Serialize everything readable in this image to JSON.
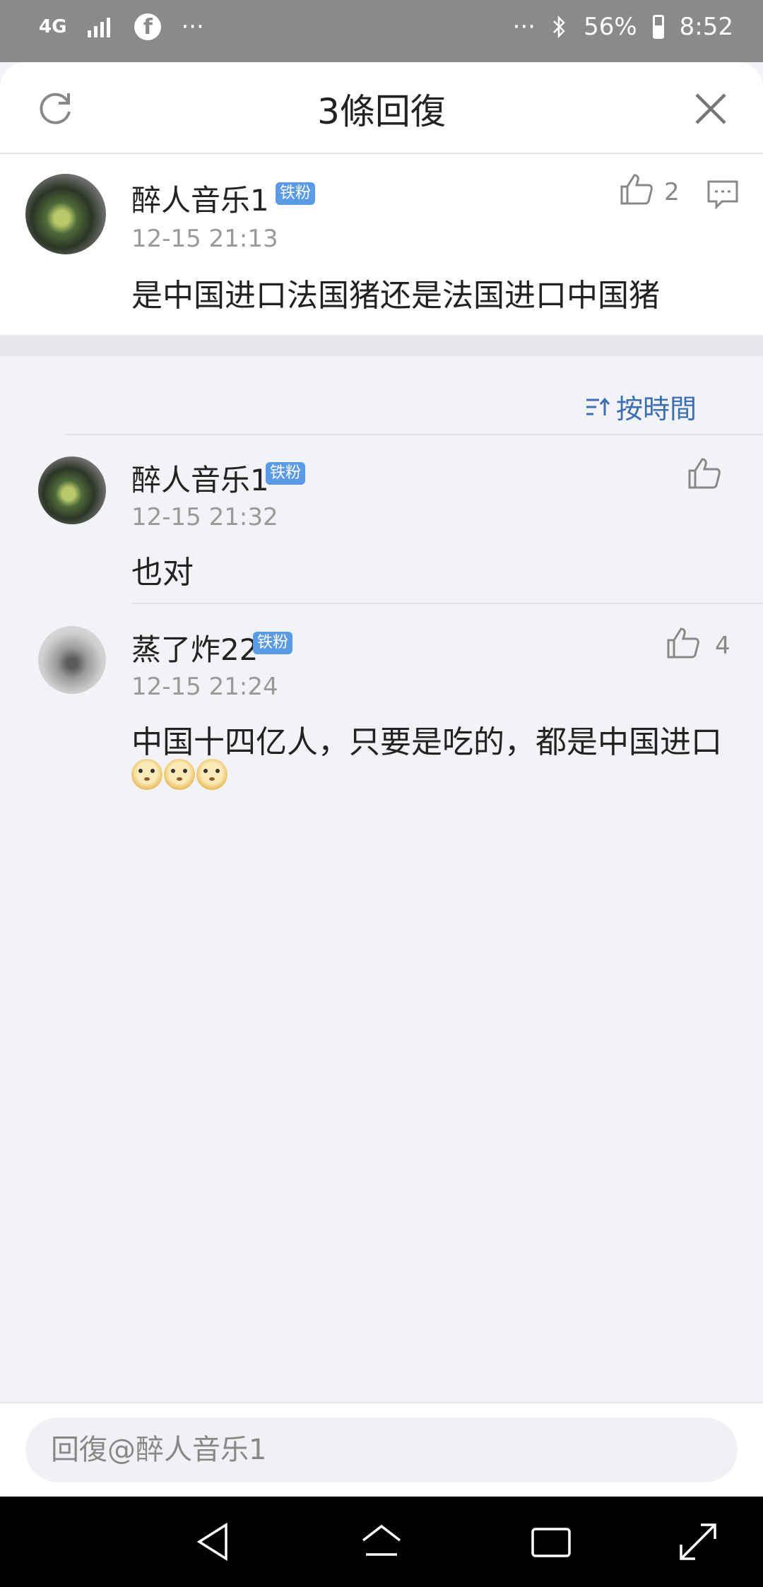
{
  "status_bar": {
    "network": "4G",
    "more_left": "···",
    "more_right": "···",
    "battery": "56%",
    "time": "8:52",
    "icons": [
      "network-4g-icon",
      "signal-icon",
      "facebook-icon",
      "bluetooth-icon",
      "battery-icon"
    ]
  },
  "header": {
    "title": "3條回復"
  },
  "main_comment": {
    "user": "醉人音乐1",
    "badge": "铁粉",
    "time": "12-15 21:13",
    "text": "是中国进口法国猪还是法国进口中国猪",
    "likes": "2"
  },
  "replies": {
    "sort_label": "按時間",
    "items": [
      {
        "user": "醉人音乐1",
        "badge": "铁粉",
        "time": "12-15 21:32",
        "text": "也对",
        "likes": ""
      },
      {
        "user": "蒸了炸22",
        "badge": "铁粉",
        "time": "12-15 21:24",
        "text": "中国十四亿人，只要是吃的，都是中国进口",
        "likes": "4",
        "emoji_count": 3
      }
    ]
  },
  "reply_input": {
    "placeholder": "回復@醉人音乐1"
  },
  "colors": {
    "accent": "#3e6fb0",
    "badge": "#5b9be6",
    "background": "#f2f3f7"
  }
}
